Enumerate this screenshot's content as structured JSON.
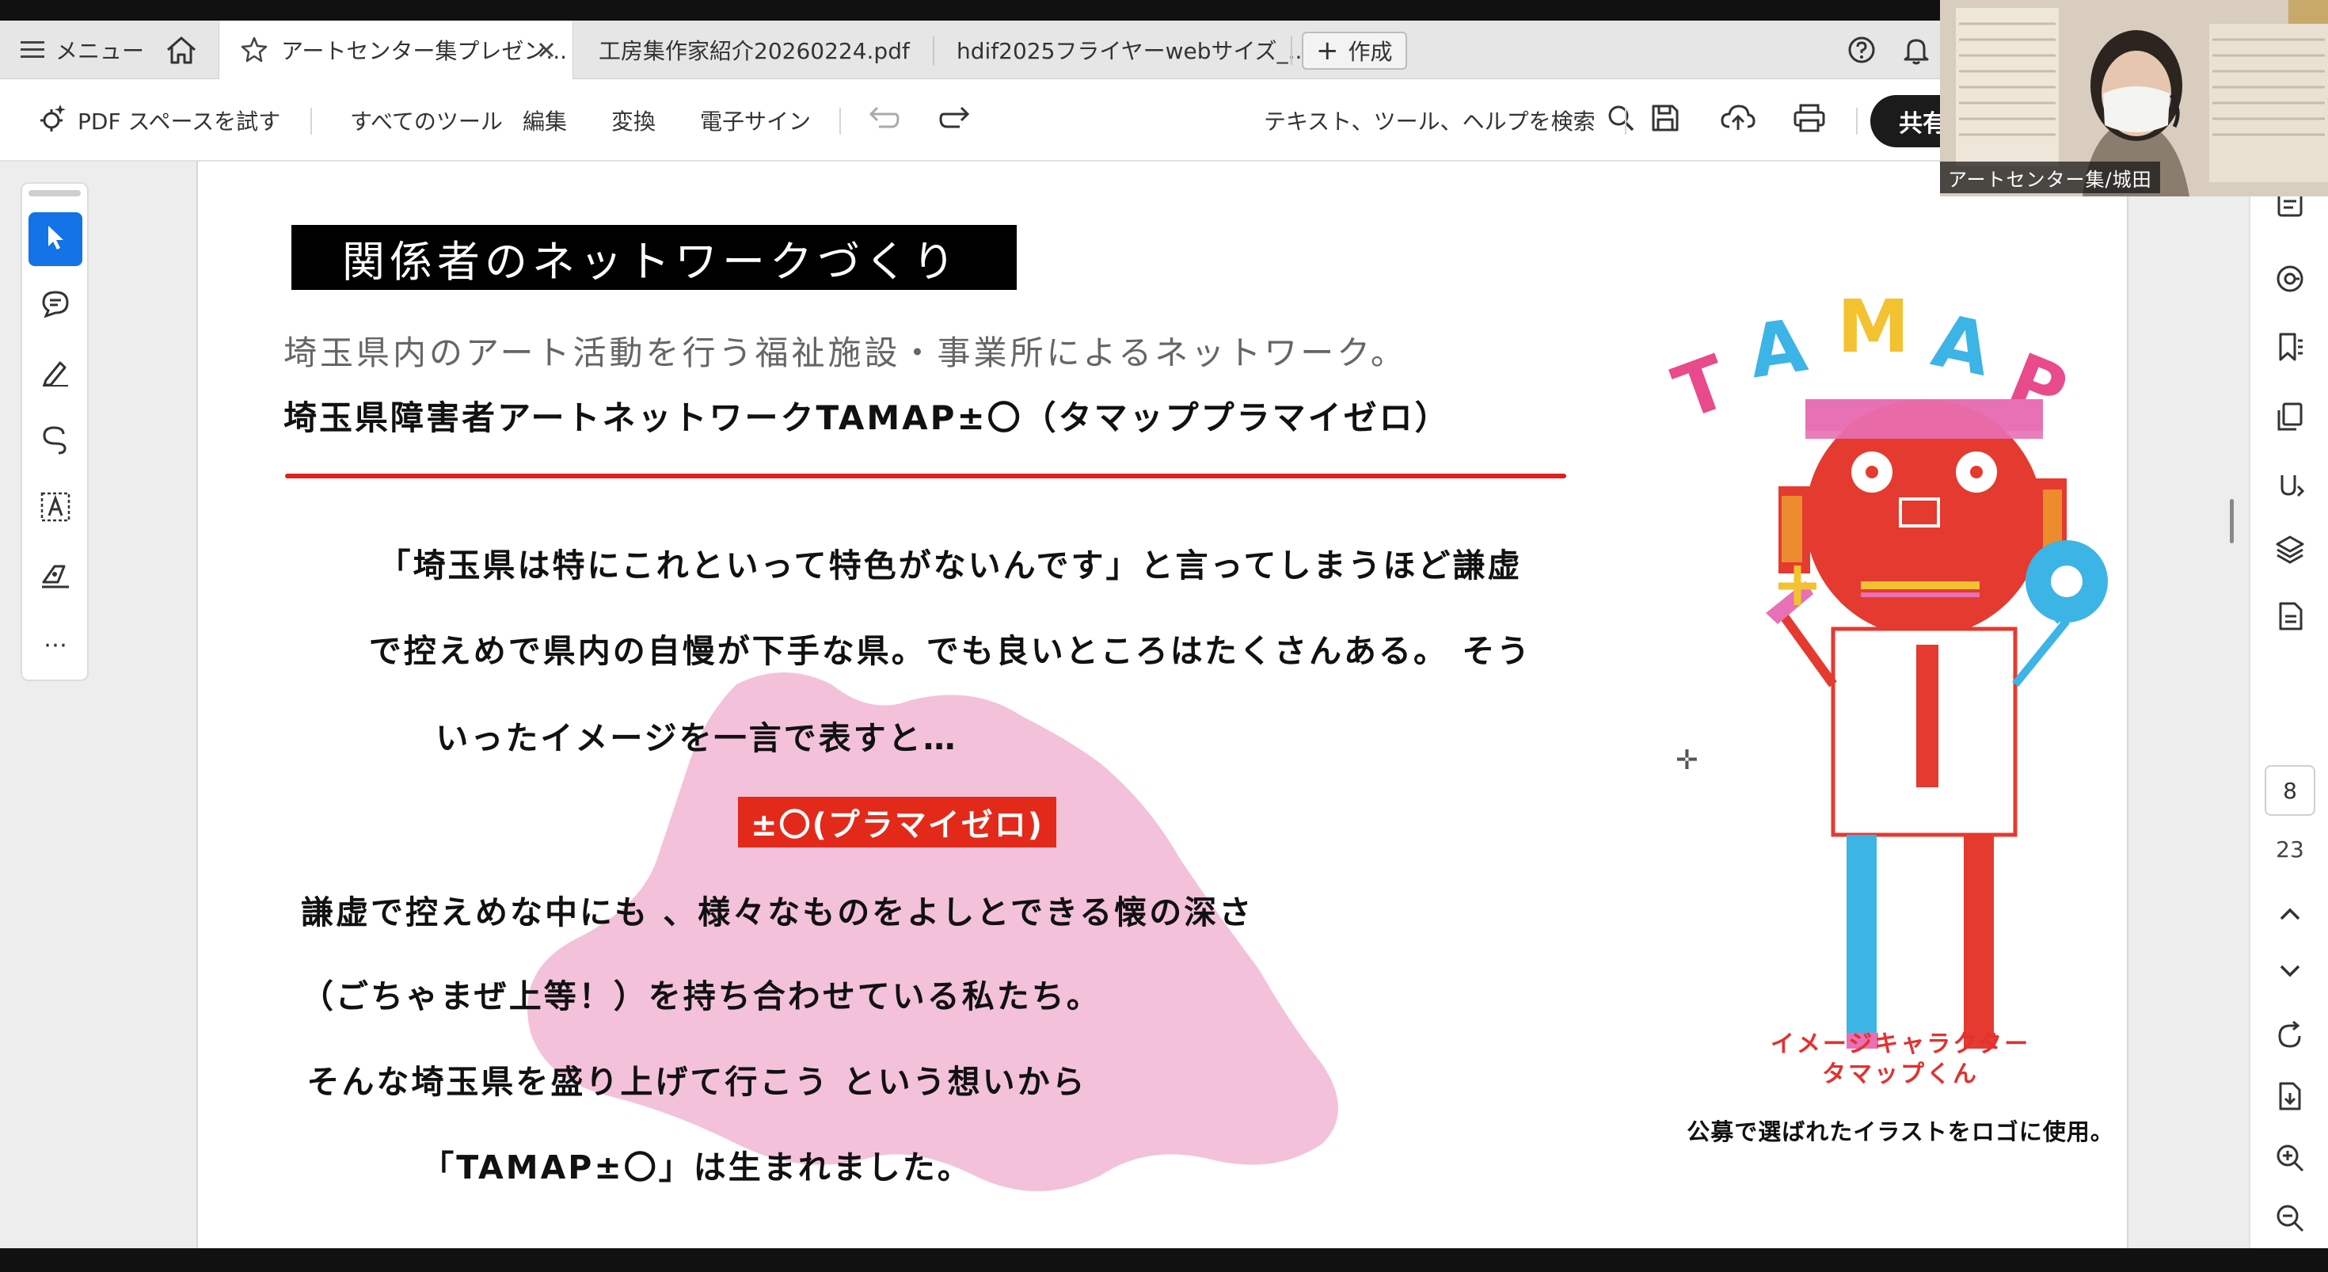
{
  "tabbar": {
    "menu_label": "メニュー",
    "tabs": [
      {
        "label": "アートセンター集プレゼン..."
      },
      {
        "label": "工房集作家紹介20260224.pdf"
      },
      {
        "label": "hdif2025フライヤーwebサイズ_..."
      }
    ],
    "create_label": "作成"
  },
  "toolbar": {
    "pdf_space_label": "PDF スペースを試す",
    "all_tools_label": "すべてのツール",
    "edit_label": "編集",
    "convert_label": "変換",
    "esign_label": "電子サイン",
    "search_label": "テキスト、ツール、ヘルプを検索",
    "share_label": "共有"
  },
  "document": {
    "heading": "関係者のネットワークづくり",
    "subtitle": "埼玉県内のアート活動を行う福祉施設・事業所によるネットワーク。",
    "bold_line": "埼玉県障害者アートネットワークTAMAP±〇（タマッププラマイゼロ）",
    "paragraphs": [
      "「埼玉県は特にこれといって特色がないんです」と言ってしまうほど謙虚",
      "で控えめで県内の自慢が下手な県。でも良いところはたくさんある。 そう",
      "いったイメージを一言で表すと…",
      "謙虚で控えめな中にも 、様々なものをよしとできる懐の深さ",
      "（ごちゃまぜ上等！）を持ち合わせている私たち。",
      "そんな埼玉県を盛り上げて行こう という想いから",
      "「TAMAP±〇」は生まれました。"
    ],
    "highlight_label": "±〇(プラマイゼロ)",
    "character_name_line1": "イメージキャラクター",
    "character_name_line2": "タマップくん",
    "logo_caption": "公募で選ばれたイラストをロゴに使用。",
    "logo_text": "TAMAP"
  },
  "navigation": {
    "current_page": "8",
    "total_pages": "23"
  },
  "video": {
    "participant_name": "アートセンター集/城田"
  },
  "colors": {
    "accent_red": "#e02020",
    "highlight_blue": "#1473e6",
    "pink_blob": "#f2b6d3",
    "character_blue": "#3cb4e6"
  }
}
